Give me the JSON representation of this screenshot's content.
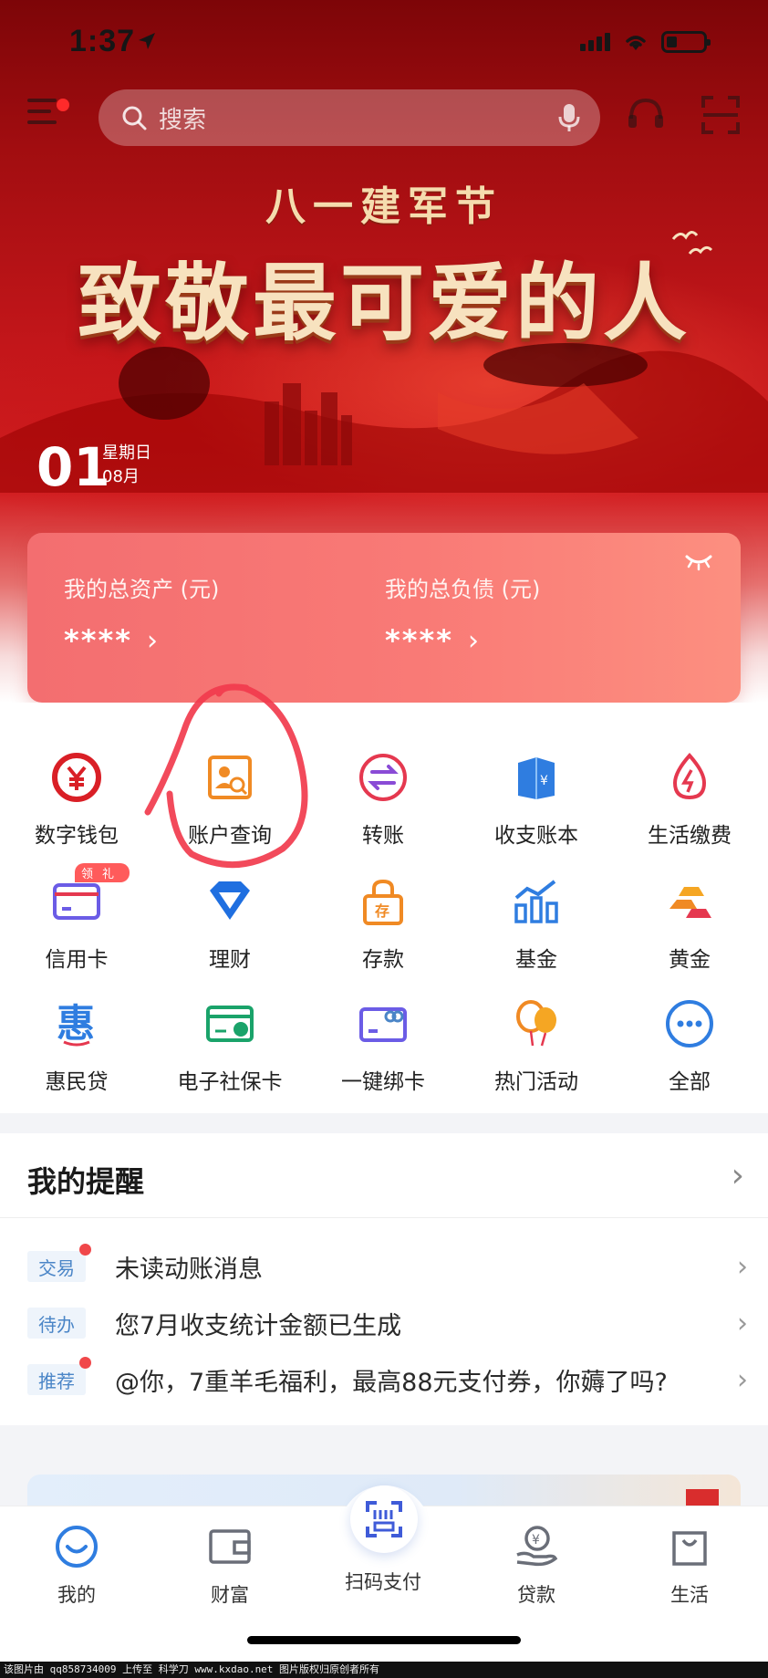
{
  "status_bar": {
    "time": "1:37"
  },
  "header": {
    "search_placeholder": "搜索"
  },
  "banner": {
    "subtitle": "八一建军节",
    "title": "致敬最可爱的人",
    "date_day": "01",
    "date_weekday": "星期日",
    "date_month": "08月"
  },
  "assets": {
    "total_assets_label": "我的总资产 (元)",
    "total_assets_value": "****",
    "total_liabilities_label": "我的总负债 (元)",
    "total_liabilities_value": "****"
  },
  "grid": {
    "items": [
      {
        "label": "数字钱包",
        "icon": "digital-yuan-icon"
      },
      {
        "label": "账户查询",
        "icon": "account-query-icon"
      },
      {
        "label": "转账",
        "icon": "transfer-icon"
      },
      {
        "label": "收支账本",
        "icon": "ledger-icon"
      },
      {
        "label": "生活缴费",
        "icon": "bill-payment-icon"
      },
      {
        "label": "信用卡",
        "icon": "credit-card-icon",
        "badge": "领礼"
      },
      {
        "label": "理财",
        "icon": "wealth-diamond-icon"
      },
      {
        "label": "存款",
        "icon": "deposit-lock-icon"
      },
      {
        "label": "基金",
        "icon": "fund-chart-icon"
      },
      {
        "label": "黄金",
        "icon": "gold-bars-icon"
      },
      {
        "label": "惠民贷",
        "icon": "huimin-loan-icon"
      },
      {
        "label": "电子社保卡",
        "icon": "social-security-card-icon"
      },
      {
        "label": "一键绑卡",
        "icon": "bind-card-icon"
      },
      {
        "label": "热门活动",
        "icon": "balloons-icon"
      },
      {
        "label": "全部",
        "icon": "more-dots-icon"
      }
    ]
  },
  "reminders": {
    "title": "我的提醒",
    "rows": [
      {
        "tag": "交易",
        "text": "未读动账消息",
        "unread": true
      },
      {
        "tag": "待办",
        "text": "您7月收支统计金额已生成",
        "unread": false
      },
      {
        "tag": "推荐",
        "text": "@你，7重羊毛福利，最高88元支付券，你薅了吗?",
        "unread": true
      }
    ]
  },
  "tabbar": {
    "items": [
      {
        "label": "我的",
        "icon": "profile-smile-icon"
      },
      {
        "label": "财富",
        "icon": "wallet-icon"
      },
      {
        "label": "扫码支付",
        "icon": "scan-pay-icon"
      },
      {
        "label": "贷款",
        "icon": "loan-hand-icon"
      },
      {
        "label": "生活",
        "icon": "shopping-bag-icon"
      }
    ]
  },
  "watermark": "该图片由 qq858734009 上传至 科学刀 www.kxdao.net 图片版权归原创者所有",
  "colors": {
    "brand_red": "#c3161a",
    "accent_blue": "#2f7de0",
    "reminder_tag_blue": "#4a85c7"
  }
}
